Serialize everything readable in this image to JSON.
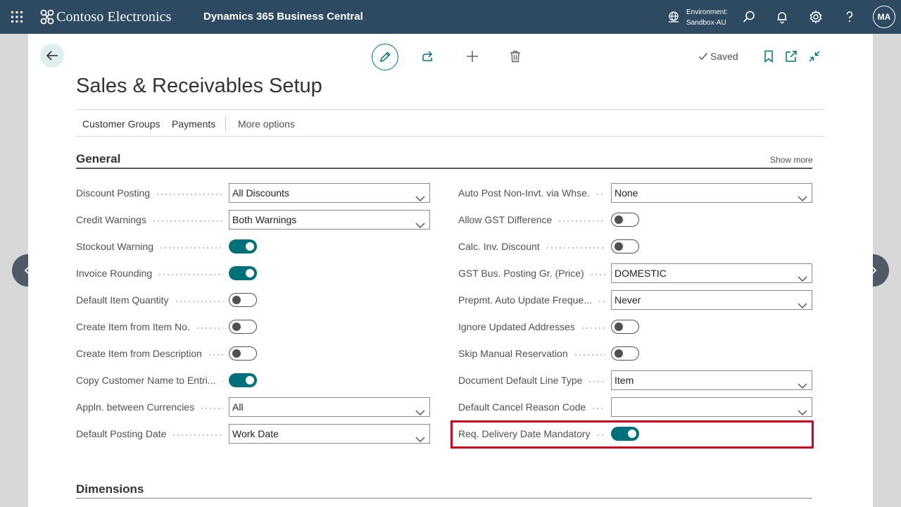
{
  "topbar": {
    "company": "Contoso Electronics",
    "product": "Dynamics 365 Business Central",
    "environment_label": "Environment:",
    "environment_value": "Sandbox-AU",
    "avatar_initials": "MA"
  },
  "actions": {
    "saved_label": "Saved"
  },
  "page": {
    "title": "Sales & Receivables Setup"
  },
  "menu": {
    "items": [
      "Customer Groups",
      "Payments"
    ],
    "more": "More options"
  },
  "general": {
    "title": "General",
    "show_more": "Show more",
    "left_fields": [
      {
        "label": "Discount Posting",
        "type": "select",
        "value": "All Discounts"
      },
      {
        "label": "Credit Warnings",
        "type": "select",
        "value": "Both Warnings"
      },
      {
        "label": "Stockout Warning",
        "type": "toggle",
        "on": true
      },
      {
        "label": "Invoice Rounding",
        "type": "toggle",
        "on": true
      },
      {
        "label": "Default Item Quantity",
        "type": "toggle",
        "on": false
      },
      {
        "label": "Create Item from Item No.",
        "type": "toggle",
        "on": false
      },
      {
        "label": "Create Item from Description",
        "type": "toggle",
        "on": false
      },
      {
        "label": "Copy Customer Name to Entri...",
        "type": "toggle",
        "on": true
      },
      {
        "label": "Appln. between Currencies",
        "type": "select",
        "value": "All"
      },
      {
        "label": "Default Posting Date",
        "type": "select",
        "value": "Work Date"
      }
    ],
    "right_fields": [
      {
        "label": "Auto Post Non-Invt. via Whse.",
        "type": "select",
        "value": "None"
      },
      {
        "label": "Allow GST Difference",
        "type": "toggle",
        "on": false
      },
      {
        "label": "Calc. Inv. Discount",
        "type": "toggle",
        "on": false
      },
      {
        "label": "GST Bus. Posting Gr. (Price)",
        "type": "select",
        "value": "DOMESTIC"
      },
      {
        "label": "Prepmt. Auto Update Freque...",
        "type": "select",
        "value": "Never"
      },
      {
        "label": "Ignore Updated Addresses",
        "type": "toggle",
        "on": false
      },
      {
        "label": "Skip Manual Reservation",
        "type": "toggle",
        "on": false
      },
      {
        "label": "Document Default Line Type",
        "type": "select",
        "value": "Item"
      },
      {
        "label": "Default Cancel Reason Code",
        "type": "select",
        "value": ""
      },
      {
        "label": "Req. Delivery Date Mandatory",
        "type": "toggle",
        "on": true
      }
    ]
  },
  "dimensions": {
    "title": "Dimensions"
  },
  "colors": {
    "topbar": "#2e4a62",
    "accent": "#00707a",
    "highlight": "#d1001f"
  }
}
